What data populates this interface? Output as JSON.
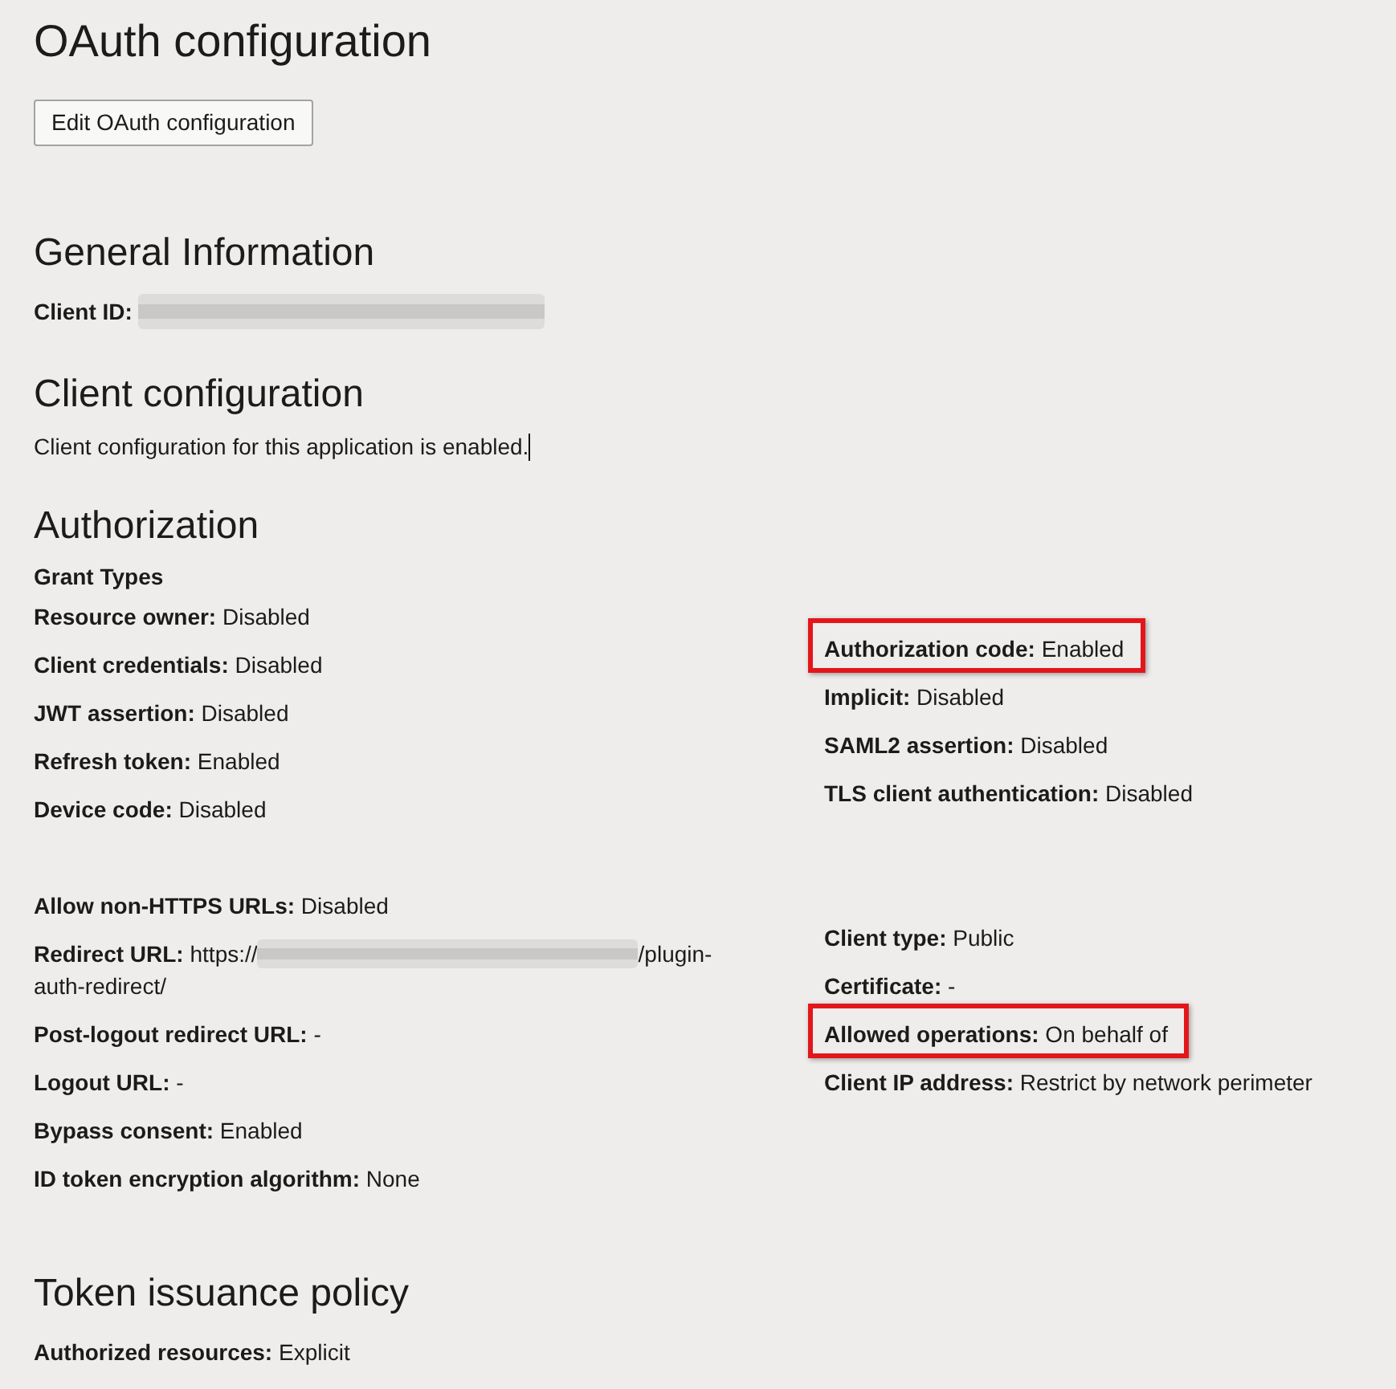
{
  "page": {
    "title": "OAuth configuration"
  },
  "edit_button": {
    "label": "Edit OAuth configuration"
  },
  "general_information": {
    "heading": "General Information",
    "fields": [
      {
        "label": "Client ID:",
        "redacted": true
      }
    ]
  },
  "client_configuration": {
    "heading": "Client configuration",
    "text": "Client configuration for this application is enabled.",
    "cursor": true
  },
  "authorization": {
    "heading": "Authorization",
    "grant_types": {
      "heading": "Grant Types",
      "left": [
        {
          "text": "**Resource owner:** Disabled",
          "highlighted": false
        },
        {
          "text": "**Client credentials:** Disabled",
          "highlighted": false
        },
        {
          "text": "**JWT assertion:** Disabled",
          "highlighted": false
        },
        {
          "text": "**Refresh token:** Enabled",
          "highlighted": false
        },
        {
          "text": "**Device code:** Disabled",
          "highlighted": false
        }
      ],
      "right": [
        {
          "text": "**Authorization code:** Enabled",
          "highlighted": true
        },
        {
          "text": "**Implicit:** Disabled",
          "highlighted": false
        },
        {
          "text": "**SAML2 assertion:** Disabled",
          "highlighted": false
        },
        {
          "text": "**TLS client authentication:** Disabled",
          "highlighted": false
        }
      ]
    },
    "details": {
      "left": [
        {
          "text": "**Allow non-HTTPS URLs:** Disabled",
          "redacted": false,
          "highlighted": false
        },
        {
          "text": "**Redirect URL:** https://",
          "redacted": true,
          "text_after": "/plugin-auth-redirect/",
          "highlighted": false
        },
        {
          "text": "**Post-logout redirect URL:** -",
          "redacted": false,
          "highlighted": false
        },
        {
          "text": "**Logout URL:** -",
          "redacted": false,
          "highlighted": false
        },
        {
          "text": "**Bypass consent:** Enabled",
          "redacted": false,
          "highlighted": false
        },
        {
          "text": "**ID token encryption algorithm:** None",
          "redacted": false,
          "highlighted": false
        }
      ],
      "right": [
        {
          "text": "**Client type:** Public",
          "highlighted": false
        },
        {
          "text": "**Certificate:** -",
          "highlighted": false
        },
        {
          "text": "**Allowed operations:** On behalf of",
          "highlighted": true
        },
        {
          "text": "**Client IP address:** Restrict by network perimeter",
          "highlighted": false
        }
      ]
    }
  },
  "token_issuance_policy": {
    "heading": "Token issuance policy",
    "fields": [
      {
        "text": "**Authorized resources:** Explicit"
      }
    ]
  }
}
